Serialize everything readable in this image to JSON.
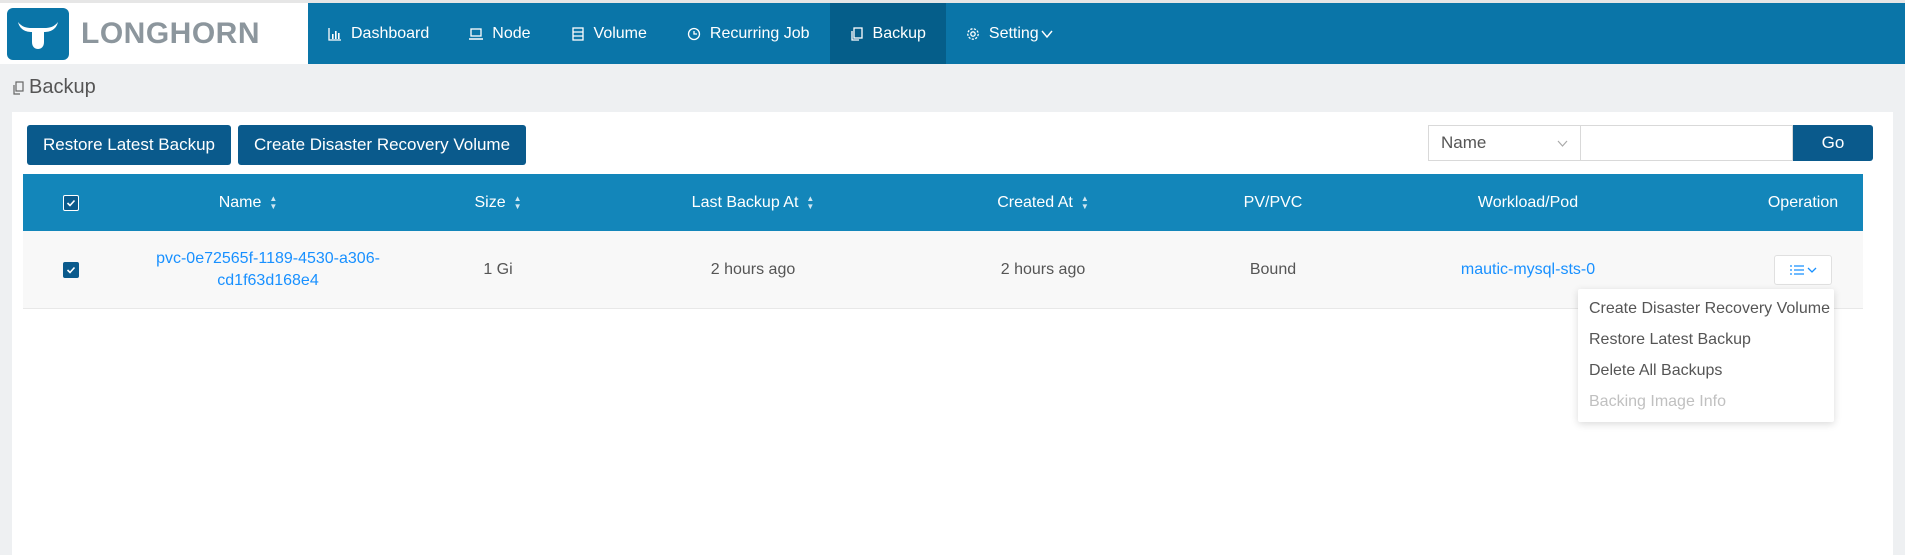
{
  "app": {
    "brand": "LONGHORN"
  },
  "nav": [
    {
      "label": "Dashboard",
      "icon": "dashboard-icon"
    },
    {
      "label": "Node",
      "icon": "node-icon"
    },
    {
      "label": "Volume",
      "icon": "volume-icon"
    },
    {
      "label": "Recurring Job",
      "icon": "clock-icon"
    },
    {
      "label": "Backup",
      "icon": "backup-icon",
      "active": true
    },
    {
      "label": "Setting",
      "icon": "gear-icon"
    }
  ],
  "page": {
    "title": "Backup"
  },
  "toolbar": {
    "restore_latest": "Restore Latest Backup",
    "create_dr": "Create Disaster Recovery Volume",
    "search_field": "Name",
    "search_value": "",
    "go": "Go"
  },
  "table": {
    "columns": [
      "Name",
      "Size",
      "Last Backup At",
      "Created At",
      "PV/PVC",
      "Workload/Pod",
      "Operation"
    ],
    "rows": [
      {
        "name_line1": "pvc-0e72565f-1189-4530-a306-",
        "name_line2": "cd1f63d168e4",
        "size": "1 Gi",
        "last_backup_at": "2 hours ago",
        "created_at": "2 hours ago",
        "pv_pvc": "Bound",
        "workload_pod": "mautic-mysql-sts-0"
      }
    ]
  },
  "operation_menu": [
    {
      "label": "Create Disaster Recovery Volume",
      "disabled": false
    },
    {
      "label": "Restore Latest Backup",
      "disabled": false
    },
    {
      "label": "Delete All Backups",
      "disabled": false
    },
    {
      "label": "Backing Image Info",
      "disabled": true
    }
  ],
  "colors": {
    "header": "#0a75a8",
    "active_nav": "#055e8a",
    "button": "#0a5a8c",
    "table_header": "#1386ba",
    "link": "#1890ff"
  }
}
